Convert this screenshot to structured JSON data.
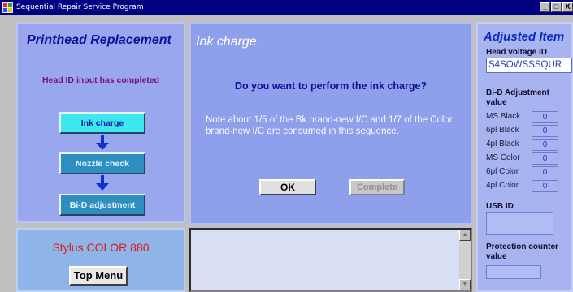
{
  "window": {
    "title": "Sequential Repair Service Program",
    "controls": [
      "_",
      "□",
      "X"
    ]
  },
  "left_panel": {
    "title": "Printhead Replacement",
    "status": "Head ID input has completed",
    "steps": [
      {
        "label": "Ink charge",
        "state": "active"
      },
      {
        "label": "Nozzle check",
        "state": "pending"
      },
      {
        "label": "Bi-D adjustment",
        "state": "pending"
      }
    ]
  },
  "model_panel": {
    "model": "Stylus COLOR 880",
    "top_menu_label": "Top Menu"
  },
  "main_panel": {
    "title": "Ink charge",
    "question": "Do you want to perform the ink charge?",
    "note": "Note about 1/5 of the Bk brand-new I/C and 1/7 of the Color brand-new I/C are consumed in this sequence.",
    "ok_label": "OK",
    "complete_label": "Complete"
  },
  "adjusted_items": {
    "title": "Adjusted Item",
    "head_voltage_label": "Head voltage ID",
    "head_voltage_value": "S4SOWSSSQUR",
    "bid_label": "Bi-D Adjustment value",
    "bid_rows": [
      {
        "label": "MS Black",
        "value": "0"
      },
      {
        "label": "6pl Black",
        "value": "0"
      },
      {
        "label": "4pl Black",
        "value": "0"
      },
      {
        "label": "MS Color",
        "value": "0"
      },
      {
        "label": "6pl Color",
        "value": "0"
      },
      {
        "label": "4pl Color",
        "value": "0"
      }
    ],
    "usb_label": "USB ID",
    "usb_value": "",
    "protection_label": "Protection counter value",
    "protection_value": ""
  },
  "colors": {
    "titlebar": "#000080",
    "panel_blue": "#8ea0ec",
    "active_step": "#3ee8f0",
    "pending_step": "#2e8ec0",
    "model_text": "#e01818"
  }
}
